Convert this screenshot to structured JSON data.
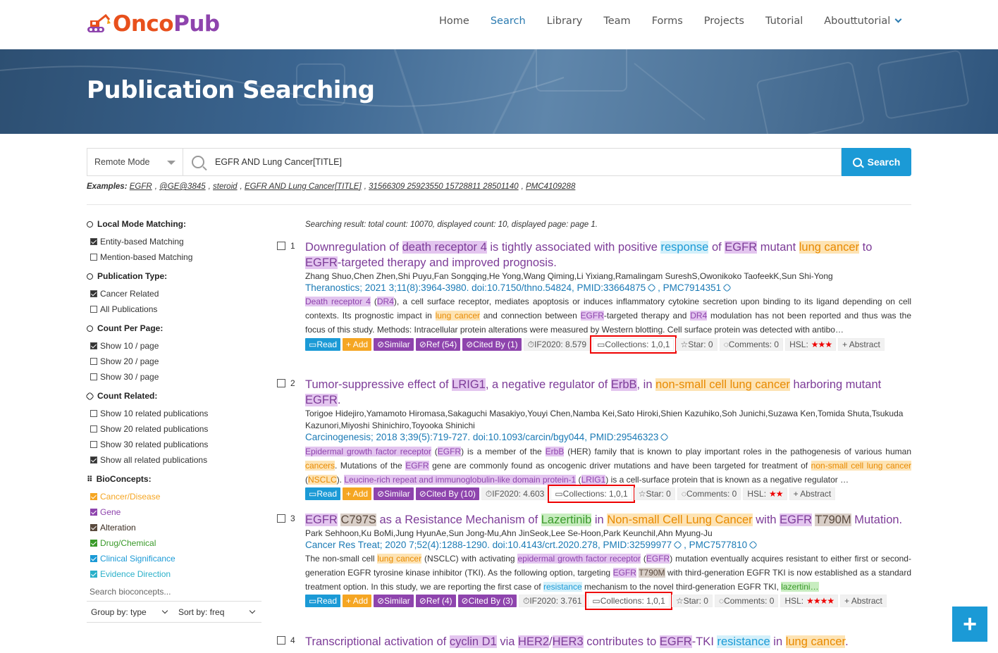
{
  "brand": {
    "part1": "Onco",
    "part2": "Pub"
  },
  "nav": {
    "items": [
      "Home",
      "Search",
      "Library",
      "Team",
      "Forms",
      "Projects",
      "Tutorial",
      "About"
    ],
    "user": "tutorial"
  },
  "banner": {
    "title": "Publication Searching"
  },
  "search": {
    "mode": "Remote Mode",
    "query": "EGFR AND Lung Cancer[TITLE]",
    "button": "Search",
    "examples_label": "Examples:",
    "examples": [
      "EGFR",
      "@GE@3845",
      "steroid",
      "EGFR AND Lung Cancer[TITLE]",
      "31566309 25923550 15728811 28501140",
      "PMC4109288"
    ]
  },
  "sidebar": {
    "local_mode": {
      "title": "Local Mode Matching:",
      "options": [
        "Entity-based Matching",
        "Mention-based Matching"
      ]
    },
    "pub_type": {
      "title": "Publication Type:",
      "options": [
        "Cancer Related",
        "All Publications"
      ]
    },
    "per_page": {
      "title": "Count Per Page:",
      "options": [
        "Show 10 / page",
        "Show 20 / page",
        "Show 30 / page"
      ]
    },
    "related": {
      "title": "Count Related:",
      "options": [
        "Show 10 related publications",
        "Show 20 related publications",
        "Show 30 related publications",
        "Show all related publications"
      ]
    },
    "bioconcepts": {
      "title": "BioConcepts:",
      "options": [
        "Cancer/Disease",
        "Gene",
        "Alteration",
        "Drug/Chemical",
        "Clinical Significance",
        "Evidence Direction"
      ]
    },
    "bio_search_placeholder": "Search bioconcepts...",
    "group_by": "Group by: type",
    "sort_by": "Sort by: freq",
    "colors": {
      "cancer": "#f5a623",
      "gene": "#8e44ad",
      "alteration": "#5a4a3e",
      "drug": "#3a9a2a",
      "clinical": "#1b9ad6",
      "evidence": "#2ab0c9"
    }
  },
  "results": {
    "summary": "Searching result: total count: 10070, displayed count: 10, displayed page: page 1.",
    "items": [
      {
        "num": "1",
        "authors": "Zhang Shuo,Chen Zhen,Shi Puyu,Fan Songqing,He Yong,Wang Qiming,Li Yixiang,Ramalingam SureshS,Owonikoko TaofeekK,Sun Shi-Yong",
        "journal": "Theranostics; 2021 3;11(8):3964-3980. doi:10.7150/thno.54824, PMID:33664875",
        "pmc": "PMC7914351",
        "buttons": [
          "Read",
          "+ Add",
          "Similar",
          "Ref (54)",
          "Cited By (1)"
        ],
        "if": "IF2020: 8.579",
        "collections": "Collections: 1,0,1",
        "star": "Star: 0",
        "comments": "Comments: 0",
        "hsl": "HSL:",
        "stars": "★★★",
        "abstract": "+ Abstract"
      },
      {
        "num": "2",
        "authors": "Torigoe Hidejiro,Yamamoto Hiromasa,Sakaguchi Masakiyo,Youyi Chen,Namba Kei,Sato Hiroki,Shien Kazuhiko,Soh Junichi,Suzawa Ken,Tomida Shuta,Tsukuda Kazunori,Miyoshi Shinichiro,Toyooka Shinichi",
        "journal": "Carcinogenesis; 2018 3;39(5):719-727. doi:10.1093/carcin/bgy044, PMID:29546323",
        "buttons": [
          "Read",
          "+ Add",
          "Similar",
          "Cited By (10)"
        ],
        "if": "IF2020: 4.603",
        "collections": "Collections: 1,0,1",
        "star": "Star: 0",
        "comments": "Comments: 0",
        "hsl": "HSL:",
        "stars": "★★",
        "abstract": "+ Abstract"
      },
      {
        "num": "3",
        "authors": "Park Sehhoon,Ku BoMi,Jung HyunAe,Sun Jong-Mu,Ahn JinSeok,Lee Se-Hoon,Park Keunchil,Ahn Myung-Ju",
        "journal": "Cancer Res Treat; 2020 7;52(4):1288-1290. doi:10.4143/crt.2020.278, PMID:32599977",
        "pmc": "PMC7577810",
        "buttons": [
          "Read",
          "+ Add",
          "Similar",
          "Ref (4)",
          "Cited By (3)"
        ],
        "if": "IF2020: 3.761",
        "collections": "Collections: 1,0,1",
        "star": "Star: 0",
        "comments": "Comments: 0",
        "hsl": "HSL:",
        "stars": "★★★★",
        "abstract": "+ Abstract"
      },
      {
        "num": "4"
      }
    ]
  },
  "fab": "+"
}
